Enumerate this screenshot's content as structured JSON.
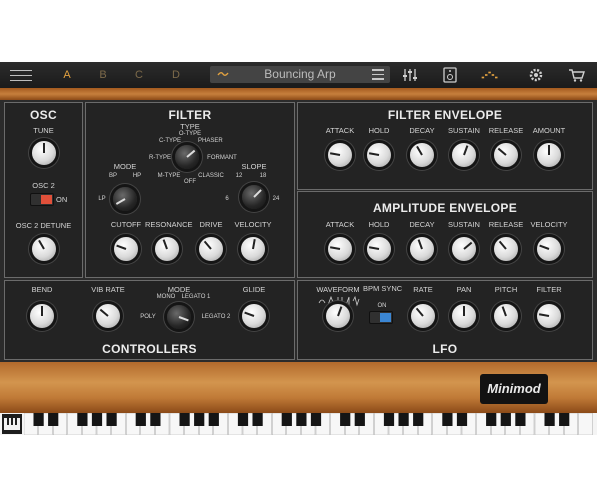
{
  "topbar": {
    "slots": [
      "A",
      "B",
      "C",
      "D"
    ],
    "preset_name": "Bouncing Arp",
    "icons": [
      "menu-icon",
      "slider-icon",
      "device-icon",
      "pattern-icon",
      "gear-icon",
      "cart-icon"
    ]
  },
  "osc": {
    "title": "OSC",
    "tune": "TUNE",
    "osc2": "OSC 2",
    "osc2_state": "ON",
    "detune": "OSC 2 DETUNE"
  },
  "filter": {
    "title": "FILTER",
    "type": "TYPE",
    "type_opts": [
      "O-TYPE",
      "C-TYPE",
      "PHASER",
      "R-TYPE",
      "FORMANT",
      "M-TYPE",
      "CLASSIC",
      "OFF"
    ],
    "mode": "MODE",
    "mode_opts": [
      "BP",
      "HP",
      "LP"
    ],
    "slope": "SLOPE",
    "slope_opts": [
      "12",
      "18",
      "6",
      "24"
    ],
    "cutoff": "CUTOFF",
    "resonance": "RESONANCE",
    "drive": "DRIVE",
    "velocity": "VELOCITY"
  },
  "filter_env": {
    "title": "FILTER ENVELOPE",
    "labels": [
      "ATTACK",
      "HOLD",
      "DECAY",
      "SUSTAIN",
      "RELEASE",
      "AMOUNT"
    ]
  },
  "amp_env": {
    "title": "AMPLITUDE ENVELOPE",
    "labels": [
      "ATTACK",
      "HOLD",
      "DECAY",
      "SUSTAIN",
      "RELEASE",
      "VELOCITY"
    ]
  },
  "controllers": {
    "title": "CONTROLLERS",
    "bend": "BEND",
    "vib_rate": "VIB RATE",
    "mode": "MODE",
    "mode_opts": [
      "MONO",
      "LEGATO 1",
      "POLY",
      "LEGATO 2"
    ],
    "glide": "GLIDE"
  },
  "lfo": {
    "title": "LFO",
    "waveform": "WAVEFORM",
    "bpm_sync": "BPM SYNC",
    "bpm_state": "ON",
    "rate": "RATE",
    "pan": "PAN",
    "pitch": "PITCH",
    "filter": "FILTER"
  },
  "logo": "Minimod",
  "colors": {
    "accent": "#e3a240",
    "toggle_red": "#e0503a",
    "toggle_blue": "#3b86d3",
    "wood": "#c67f3c"
  }
}
